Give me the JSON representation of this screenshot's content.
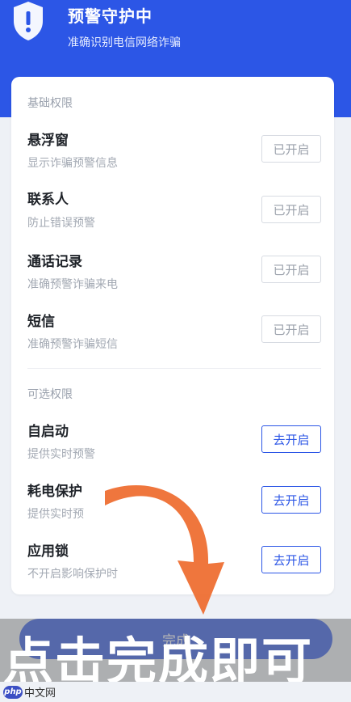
{
  "header": {
    "title": "预警守护中",
    "subtitle": "准确识别电信网络诈骗",
    "icon": "shield-exclamation-icon"
  },
  "basic_section": {
    "label": "基础权限",
    "items": [
      {
        "title": "悬浮窗",
        "desc": "显示诈骗预警信息",
        "button": "已开启"
      },
      {
        "title": "联系人",
        "desc": "防止错误预警",
        "button": "已开启"
      },
      {
        "title": "通话记录",
        "desc": "准确预警诈骗来电",
        "button": "已开启"
      },
      {
        "title": "短信",
        "desc": "准确预警诈骗短信",
        "button": "已开启"
      }
    ]
  },
  "optional_section": {
    "label": "可选权限",
    "items": [
      {
        "title": "自启动",
        "desc": "提供实时预警",
        "button": "去开启"
      },
      {
        "title": "耗电保护",
        "desc": "提供实时预",
        "button": "去开启"
      },
      {
        "title": "应用锁",
        "desc": "不开启影响保护时",
        "button": "去开启"
      }
    ]
  },
  "footer": {
    "done_label": "完成"
  },
  "overlay": {
    "caption": "点击完成即可",
    "watermark": "中文网",
    "watermark_logo": "php"
  },
  "colors": {
    "accent": "#2c56e6",
    "arrow": "#ee6a2d"
  }
}
